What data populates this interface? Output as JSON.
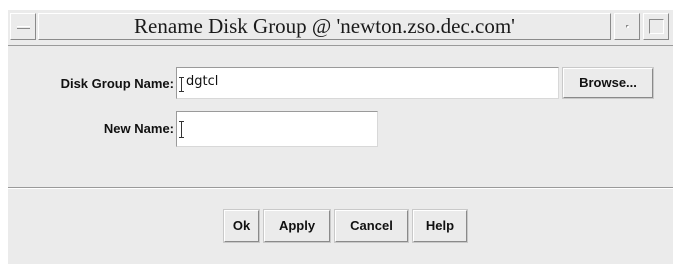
{
  "window": {
    "title": "Rename Disk Group @ 'newton.zso.dec.com'"
  },
  "form": {
    "disk_group_label": "Disk Group Name:",
    "disk_group_value": "dgtcl",
    "browse_label": "Browse...",
    "new_name_label": "New Name:",
    "new_name_value": ""
  },
  "buttons": {
    "ok": "Ok",
    "apply": "Apply",
    "cancel": "Cancel",
    "help": "Help"
  },
  "icons": {
    "window_menu": "window-menu-icon",
    "minimize": "minimize-icon",
    "maximize": "maximize-icon"
  },
  "colors": {
    "window_bg": "#ebebeb",
    "field_bg": "#ffffff",
    "text": "#111111"
  }
}
